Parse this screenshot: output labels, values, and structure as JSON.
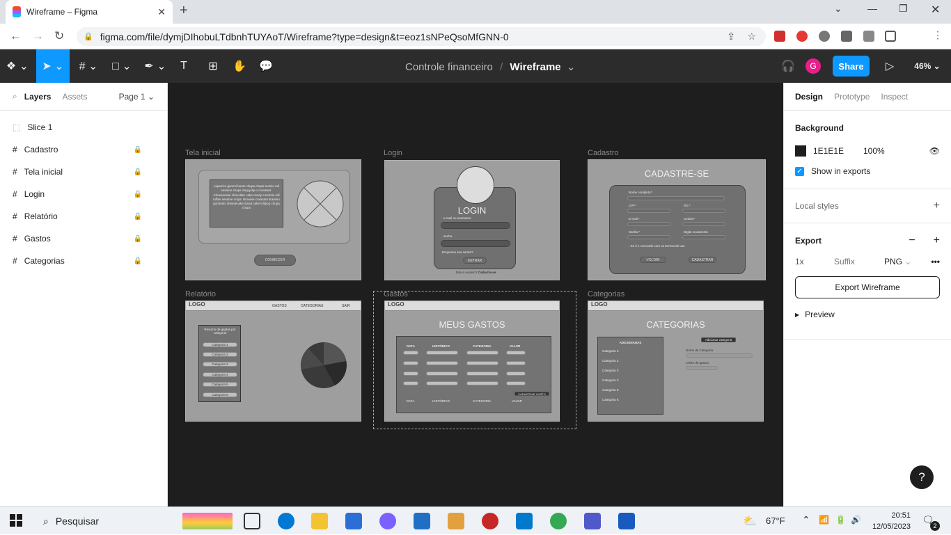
{
  "browser": {
    "tab_title": "Wireframe – Figma",
    "url": "figma.com/file/dymjDIhobuLTdbnhTUYAoT/Wireframe?type=design&t=eoz1sNPeQsoMfGNN-0",
    "profile_initial": "G"
  },
  "figma": {
    "project": "Controle financeiro",
    "file": "Wireframe",
    "user_initial": "G",
    "share_label": "Share",
    "zoom": "46%"
  },
  "layers_panel": {
    "tab_layers": "Layers",
    "tab_assets": "Assets",
    "page": "Page 1",
    "items": [
      {
        "name": "Slice 1",
        "locked": false
      },
      {
        "name": "Cadastro",
        "locked": true
      },
      {
        "name": "Tela inicial",
        "locked": true
      },
      {
        "name": "Login",
        "locked": true
      },
      {
        "name": "Relatório",
        "locked": true
      },
      {
        "name": "Gastos",
        "locked": true
      },
      {
        "name": "Categorias",
        "locked": true
      }
    ]
  },
  "canvas": {
    "frames": {
      "tela_inicial": {
        "label": "Tela inicial",
        "lorem": "Liquorice gummi bears chupa chups tootsie roll sesame snaps icing jelly-o croissant. Cheesecake chocolate cake candy a tootsie roll toffee sesame crops. Brownie croissant tiramisu gummies cheesecake donut cake lollipop chupa chups",
        "button": "CONHECER"
      },
      "login": {
        "label": "Login",
        "title": "LOGIN",
        "email": "e-mail ou username",
        "senha": "senha",
        "forgot": "Esqueceu sua senha?",
        "button": "ENTRAR",
        "signup_q": "Não é usuário?",
        "signup": "Cadastre-se"
      },
      "cadastro": {
        "label": "Cadastro",
        "title": "CADASTRE-SE",
        "nome": "Nome completo*",
        "cpf": "CPF*",
        "rg": "RG *",
        "email": "E-mail *",
        "celular": "Celular*",
        "senha": "Senha *",
        "senha2": "Digite novamente",
        "termos": "Eu li e concordo com os termos de uso",
        "voltar": "VOLTAR",
        "cadastrar": "CADASTRAR"
      },
      "relatorio": {
        "label": "Relatório",
        "logo": "LOGO",
        "nav": [
          "GASTOS",
          "CATEGORIAS",
          "SAIR"
        ],
        "box_title": "Resumo de gastos por categoria",
        "cats": [
          "Categoria 1",
          "Categoria 2",
          "Categoria 3",
          "Categoria 4",
          "Categoria 5",
          "Categoria 6"
        ]
      },
      "gastos": {
        "label": "Gastos",
        "logo": "LOGO",
        "title": "MEUS GASTOS",
        "cols": [
          "DATA",
          "HISTÓRICO",
          "CATEGORIA",
          "VALOR"
        ],
        "button": "CADASTRAR GASTO"
      },
      "categorias": {
        "label": "Categorias",
        "logo": "LOGO",
        "title": "CATEGORIAS",
        "added": "ADICIONADAS",
        "add_button": "Adicionar categoria",
        "name_label": "Nome da Categoria:",
        "limit_label": "Limite de gastos:",
        "cats": [
          "Categoria 1:",
          "Categoria 2:",
          "Categoria 3:",
          "Categoria 4:",
          "Categoria 5:",
          "Categoria 6:"
        ]
      }
    }
  },
  "design_panel": {
    "tabs": [
      "Design",
      "Prototype",
      "Inspect"
    ],
    "background_title": "Background",
    "bg_hex": "1E1E1E",
    "bg_opacity": "100%",
    "show_in_exports": "Show in exports",
    "local_styles": "Local styles",
    "export_title": "Export",
    "export_scale": "1x",
    "export_suffix_placeholder": "Suffix",
    "export_format": "PNG",
    "export_button": "Export Wireframe",
    "preview": "Preview"
  },
  "taskbar": {
    "search": "Pesquisar",
    "weather": "67°F",
    "time": "20:51",
    "date": "12/05/2023",
    "notif_count": "2"
  },
  "colors": {
    "accent": "#0d99ff",
    "figma_bar": "#2c2c2c",
    "canvas": "#1e1e1e",
    "avatar_pink": "#e91e8c"
  }
}
